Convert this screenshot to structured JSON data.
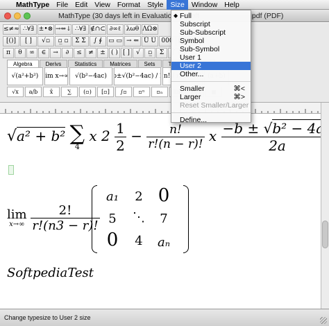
{
  "menubar": {
    "apple": "",
    "items": [
      "MathType",
      "File",
      "Edit",
      "View",
      "Format",
      "Style",
      "Size",
      "Window",
      "Help"
    ]
  },
  "window": {
    "title_left": "MathType (30 days left in Evaluation) – Soft",
    "title_right": ".pdf (PDF)"
  },
  "toolbar": {
    "row1": [
      "≤≠≈",
      "∴∀∃",
      "±•⊗",
      "→⇔↓",
      "∴∀∃",
      "∉∩⊂",
      "∂∞ℓ",
      "λωθ",
      "ΛΩ⊗"
    ],
    "row2": [
      "[()]",
      "[ ]",
      "√▫",
      "▫̲ ▫",
      "Σ Σ",
      "∫ ∮",
      "▭ ▭",
      "→ ⇐",
      "Ü Ú",
      "000",
      "▦ ▦"
    ],
    "row3": [
      "π",
      "θ",
      "∞",
      "∈",
      "→",
      "∂",
      "≤",
      "≠",
      "±",
      "( )",
      "[ ]",
      "√",
      "▫̲",
      "Σ",
      "∫",
      "a"
    ],
    "tabs": [
      "Algebra",
      "Derivs",
      "Statistics",
      "Matrices",
      "Sets",
      "Trig",
      "Geome"
    ],
    "templates": [
      "√(a²+b²)",
      "lim x→∞",
      "√(b²−4ac)",
      "−b±√(b²−4ac) / 2a",
      "n! / r!(n−r)!",
      "(a+b)"
    ],
    "templates2": [
      "√x",
      "a/b",
      "x̄",
      "∑",
      "(▫)",
      "[▫]",
      "∫▫",
      "▫ⁿ",
      "▫ₙ",
      "lim",
      "∂/∂x",
      "▦"
    ]
  },
  "size_menu": {
    "items": [
      {
        "label": "Full",
        "checked": true
      },
      {
        "label": "Subscript"
      },
      {
        "label": "Sub-Subscript"
      },
      {
        "label": "Symbol"
      },
      {
        "label": "Sub-Symbol"
      },
      {
        "label": "User 1"
      },
      {
        "label": "User 2",
        "highlighted": true
      },
      {
        "label": "Other..."
      },
      {
        "sep": true
      },
      {
        "label": "Smaller",
        "shortcut": "⌘<"
      },
      {
        "label": "Larger",
        "shortcut": "⌘>"
      },
      {
        "label": "Reset Smaller/Larger",
        "disabled": true
      },
      {
        "sep": true
      },
      {
        "label": "Define..."
      }
    ]
  },
  "document": {
    "eq1": {
      "sqrt_body": "a² + b²",
      "sum": "∑",
      "sum_lower": "4",
      "x2": "x 2",
      "half_num": "1",
      "half_den": "2",
      "minus": "−",
      "fact_num": "n!",
      "fact_den": "r!(n − r)!",
      "x": "x",
      "quad_num_pre": "−b ± ",
      "quad_num_rad": "b² − 4ac",
      "quad_den": "2a"
    },
    "eq2": {
      "lim": "lim",
      "lim_sub": "x→∞",
      "frac_num": "2!",
      "frac_den": "r!(n3 − r)!",
      "matrix": [
        [
          "a₁",
          "2",
          "0"
        ],
        [
          "5",
          "⋱",
          "7"
        ],
        [
          "0",
          "4",
          "aₙ"
        ]
      ]
    },
    "text": "SoftpediaTest"
  },
  "statusbar": {
    "text": "Change typesize to User 2 size"
  }
}
